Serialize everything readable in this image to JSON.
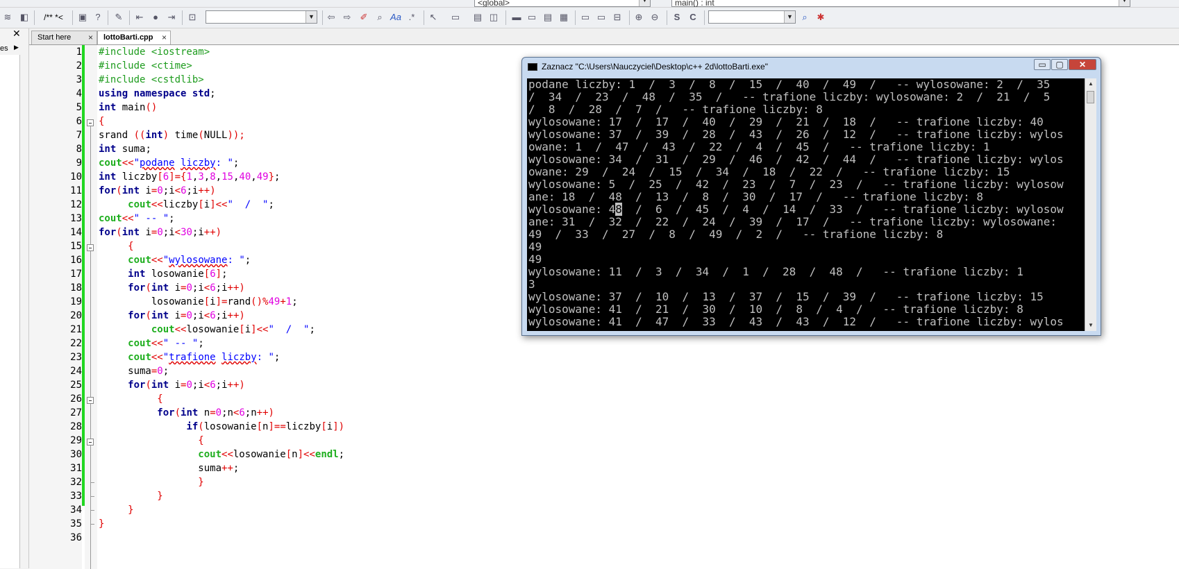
{
  "toolbar": {
    "scope_combo": "<global>",
    "function_combo": "main() : int",
    "comment_label": "/** *<",
    "search_combo": "",
    "aa_label": "Aa",
    "s_label": "S",
    "c_label": "C"
  },
  "left_panel": {
    "close": "✕",
    "label": "es",
    "arrow": "▶"
  },
  "tabs": [
    {
      "label": "Start here"
    },
    {
      "label": "lottoBarti.cpp"
    }
  ],
  "editor": {
    "line_numbers": [
      "1",
      "2",
      "3",
      "4",
      "5",
      "6",
      "7",
      "8",
      "9",
      "10",
      "11",
      "12",
      "13",
      "14",
      "15",
      "16",
      "17",
      "18",
      "19",
      "20",
      "21",
      "22",
      "23",
      "24",
      "25",
      "26",
      "27",
      "28",
      "29",
      "30",
      "31",
      "32",
      "33",
      "34",
      "35",
      "36"
    ]
  },
  "console": {
    "title": "Zaznacz \"C:\\Users\\Nauczyciel\\Desktop\\c++ 2d\\lottoBarti.exe\"",
    "min": "▭",
    "max": "▢",
    "close": "✕",
    "lines": [
      "podane liczby: 1  /  3  /  8  /  15  /  40  /  49  /   -- wylosowane: 2  /  35",
      "/  34  /  23  /  48  /  35  /   -- trafione liczby: wylosowane: 2  /  21  /  5",
      "/  8  /  28  /  7  /   -- trafione liczby: 8",
      "wylosowane: 17  /  17  /  40  /  29  /  21  /  18  /   -- trafione liczby: 40",
      "wylosowane: 37  /  39  /  28  /  43  /  26  /  12  /   -- trafione liczby: wylos",
      "owane: 1  /  47  /  43  /  22  /  4  /  45  /   -- trafione liczby: 1",
      "wylosowane: 34  /  31  /  29  /  46  /  42  /  44  /   -- trafione liczby: wylos",
      "owane: 29  /  24  /  15  /  34  /  18  /  22  /   -- trafione liczby: 15",
      "wylosowane: 5  /  25  /  42  /  23  /  7  /  23  /   -- trafione liczby: wylosow",
      "ane: 18  /  48  /  13  /  8  /  30  /  17  /   -- trafione liczby: 8",
      "wylosowane: 4",
      "ane: 31  /  32  /  22  /  24  /  39  /  17  /   -- trafione liczby: wylosowane:",
      "49  /  33  /  27  /  8  /  49  /  2  /   -- trafione liczby: 8",
      "49",
      "49",
      "wylosowane: 11  /  3  /  34  /  1  /  28  /  48  /   -- trafione liczby: 1",
      "3",
      "wylosowane: 37  /  10  /  13  /  37  /  15  /  39  /   -- trafione liczby: 15",
      "wylosowane: 41  /  21  /  30  /  10  /  8  /  4  /   -- trafione liczby: 8",
      "wylosowane: 41  /  47  /  33  /  43  /  43  /  12  /   -- trafione liczby: wylos"
    ],
    "cursor_char": "8",
    "line11_rest": "  /  6  /  45  /  4  /  14  /  33  /   -- trafione liczby: wylosow"
  }
}
